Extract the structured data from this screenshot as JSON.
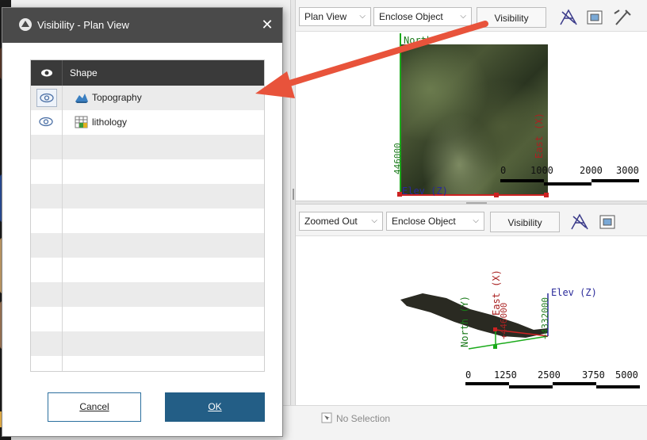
{
  "dialog": {
    "title": "Visibility - Plan View",
    "close_icon": "close-icon",
    "table": {
      "header_icon": "eye-icon",
      "column_shape": "Shape",
      "rows": [
        {
          "label": "Topography",
          "icon": "topography-icon",
          "visible": true
        },
        {
          "label": "lithology",
          "icon": "grid-table-icon",
          "visible": true
        }
      ]
    },
    "cancel_label": "Cancel",
    "ok_label": "OK"
  },
  "top_pane": {
    "view_select": "Plan View",
    "enclose_select": "Enclose Object",
    "visibility_label": "Visibility",
    "axes": {
      "north": "North",
      "elev": "Elev (Z)",
      "east": "East (X)",
      "coord": "446000"
    },
    "scale": {
      "labels": [
        "0",
        "1000",
        "2000",
        "3000"
      ]
    }
  },
  "bottom_pane": {
    "view_select": "Zoomed Out",
    "enclose_select": "Enclose Object",
    "visibility_label": "Visibility",
    "axes": {
      "elev": "Elev (Z)",
      "east": "East (X)",
      "north": "North (Y)",
      "coord1": "+446000",
      "coord2": "+4332000"
    },
    "scale": {
      "labels": [
        "0",
        "1250",
        "2500",
        "3750",
        "5000"
      ]
    }
  },
  "status": {
    "text": "No Selection"
  },
  "colors": {
    "accent": "#235e86",
    "arrow": "#e8533b",
    "title_bar": "#4a4a4a"
  }
}
